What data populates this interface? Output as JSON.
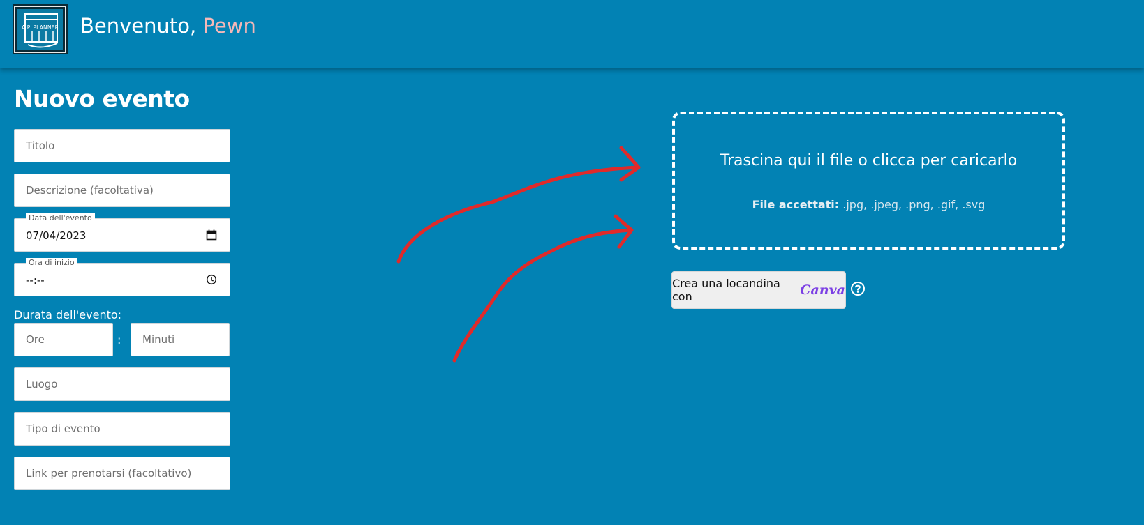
{
  "header": {
    "logo_text": "A.P. PLANNER",
    "greeting": "Benvenuto,",
    "username": "Pewn"
  },
  "form": {
    "title": "Nuovo evento",
    "titolo_placeholder": "Titolo",
    "descrizione_placeholder": "Descrizione (facoltativa)",
    "data_label": "Data dell'evento",
    "data_value": "07/04/2023",
    "ora_label": "Ora di inizio",
    "ora_value": "--:--",
    "durata_label": "Durata dell'evento:",
    "ore_placeholder": "Ore",
    "colon": ":",
    "minuti_placeholder": "Minuti",
    "luogo_placeholder": "Luogo",
    "tipo_placeholder": "Tipo di evento",
    "link_placeholder": "Link per prenotarsi (facoltativo)"
  },
  "upload": {
    "title": "Trascina qui il file o clicca per caricarlo",
    "accepted_label": "File accettati:",
    "accepted_types": ".jpg, .jpeg, .png, .gif, .svg"
  },
  "canva": {
    "button_label": "Crea una locandina con",
    "logo_text": "Canva"
  },
  "icons": {
    "calendar": "calendar-icon",
    "clock": "clock-icon",
    "help": "help-icon"
  },
  "colors": {
    "background": "#0282b4",
    "username": "#f5b8b8",
    "arrows": "#e02a2a",
    "canva": "#7b3fe4"
  }
}
